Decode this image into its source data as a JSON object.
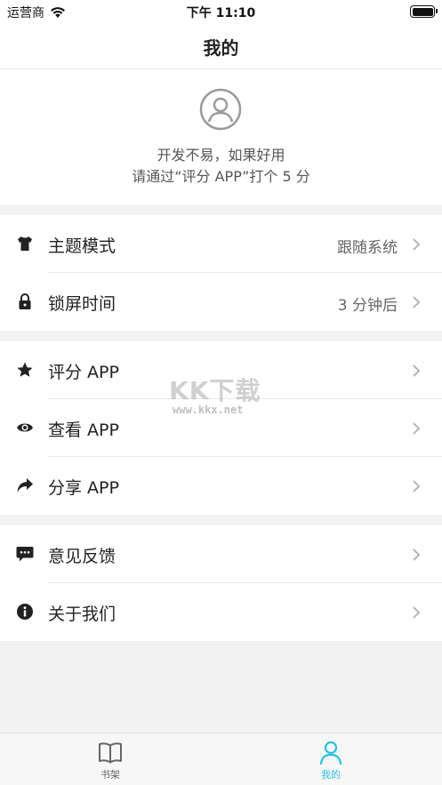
{
  "status": {
    "carrier": "运营商",
    "time": "下午 11:10"
  },
  "nav": {
    "title": "我的"
  },
  "profile": {
    "line1": "开发不易，如果好用",
    "line2": "请通过“评分 APP”打个 5 分"
  },
  "settings": [
    {
      "icon": "shirt-icon",
      "label": "主题模式",
      "value": "跟随系统"
    },
    {
      "icon": "lock-icon",
      "label": "锁屏时间",
      "value": "3 分钟后"
    }
  ],
  "app": [
    {
      "icon": "star-icon",
      "label": "评分 APP"
    },
    {
      "icon": "eye-icon",
      "label": "查看 APP"
    },
    {
      "icon": "share-icon",
      "label": "分享 APP"
    }
  ],
  "about": [
    {
      "icon": "message-icon",
      "label": "意见反馈"
    },
    {
      "icon": "info-icon",
      "label": "关于我们"
    }
  ],
  "watermark": {
    "logo": "KK下载",
    "url": "www.kkx.net"
  },
  "tabs": [
    {
      "icon": "book-icon",
      "label": "书架",
      "active": false
    },
    {
      "icon": "person-icon",
      "label": "我的",
      "active": true
    }
  ],
  "colors": {
    "accent": "#2ec0e0",
    "background": "#f2f2f2"
  }
}
